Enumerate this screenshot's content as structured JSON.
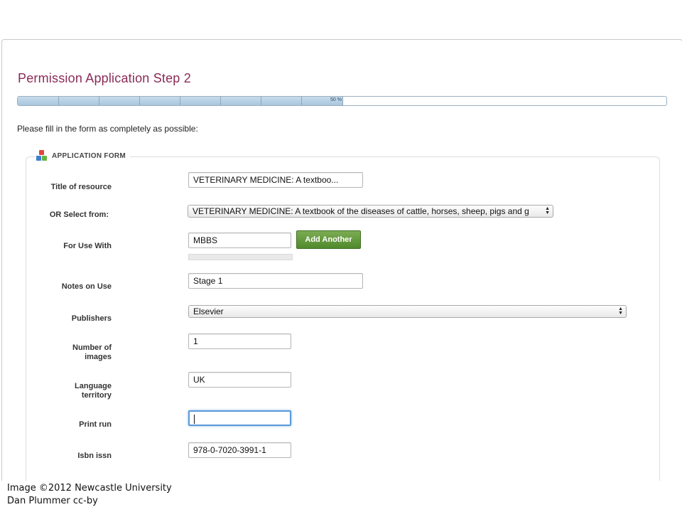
{
  "page": {
    "title": "Permission Application Step 2",
    "intro": "Please fill in the form as completely as possible:"
  },
  "progress": {
    "percent": 50,
    "label": "50 %"
  },
  "form": {
    "legend": "APPLICATION FORM",
    "title_of_resource": {
      "label": "Title of resource",
      "value": "VETERINARY MEDICINE: A textboo..."
    },
    "or_select_from": {
      "label": "OR Select from:",
      "value": "VETERINARY MEDICINE: A textbook of the diseases of cattle, horses, sheep, pigs and g"
    },
    "for_use_with": {
      "label": "For Use With",
      "value": "MBBS",
      "button": "Add Another"
    },
    "notes_on_use": {
      "label": "Notes on Use",
      "value": "Stage 1"
    },
    "publishers": {
      "label": "Publishers",
      "value": "Elsevier"
    },
    "number_of_images": {
      "label_line1": "Number of",
      "label_line2": "images",
      "value": "1"
    },
    "language_territory": {
      "label_line1": "Language",
      "label_line2": "territory",
      "value": "UK"
    },
    "print_run": {
      "label": "Print run",
      "value": ""
    },
    "isbn_issn": {
      "label": "Isbn issn",
      "value": "978-0-7020-3991-1"
    }
  },
  "caption": {
    "line1": "Image ©2012 Newcastle University",
    "line2": "Dan Plummer cc-by"
  },
  "colors": {
    "title": "#8a2b56",
    "button": "#5a9433",
    "focus": "#5b9ad8",
    "progress": "#a9c6dd"
  }
}
